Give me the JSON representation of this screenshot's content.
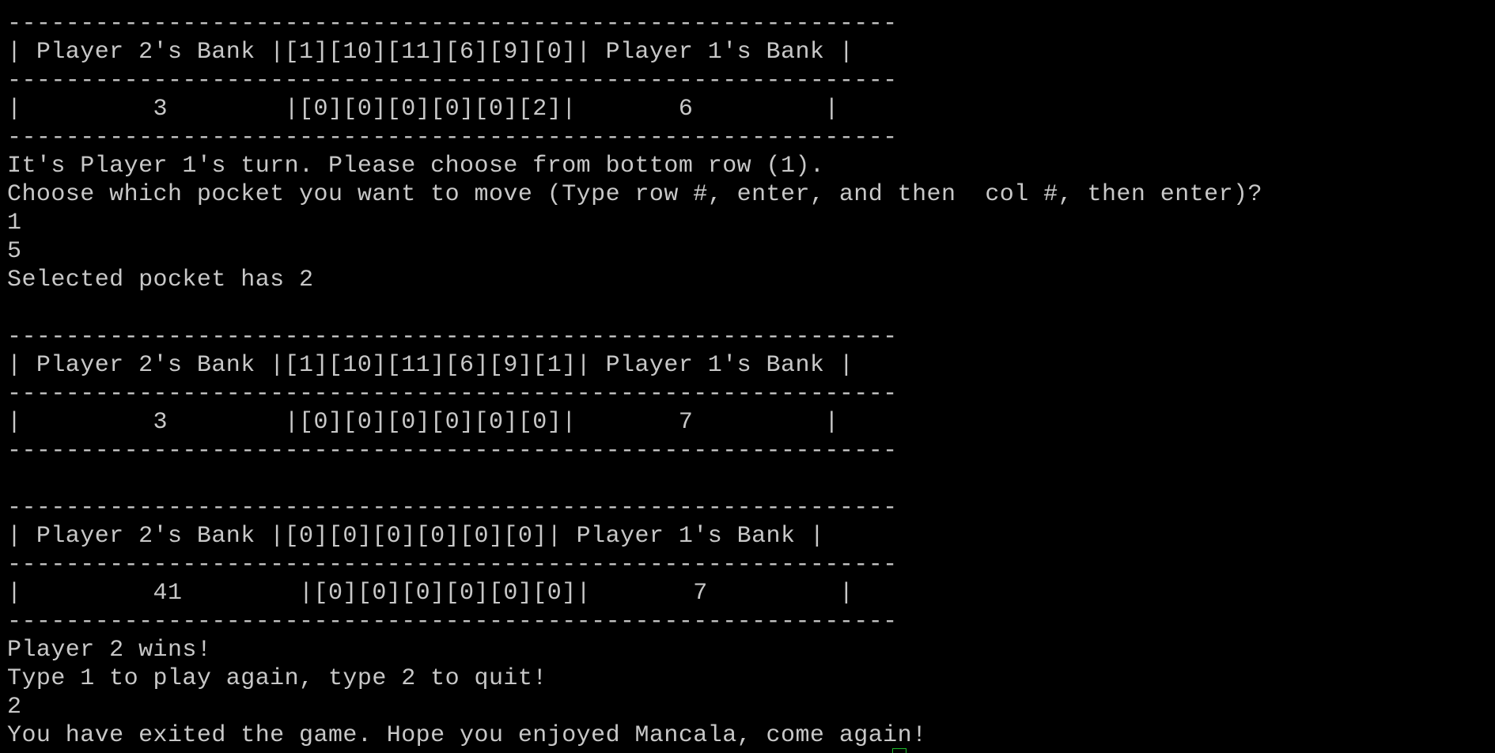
{
  "terminal": {
    "lines": [
      "-------------------------------------------------------------",
      "| Player 2's Bank |[1][10][11][6][9][0]| Player 1's Bank |",
      "-------------------------------------------------------------",
      "|         3        |[0][0][0][0][0][2]|       6         |",
      "-------------------------------------------------------------",
      "It's Player 1's turn. Please choose from bottom row (1).",
      "Choose which pocket you want to move (Type row #, enter, and then  col #, then enter)?",
      "1",
      "5",
      "Selected pocket has 2",
      "",
      "-------------------------------------------------------------",
      "| Player 2's Bank |[1][10][11][6][9][1]| Player 1's Bank |",
      "-------------------------------------------------------------",
      "|         3        |[0][0][0][0][0][0]|       7         |",
      "-------------------------------------------------------------",
      "",
      "-------------------------------------------------------------",
      "| Player 2's Bank |[0][0][0][0][0][0]| Player 1's Bank |",
      "-------------------------------------------------------------",
      "|         41        |[0][0][0][0][0][0]|       7         |",
      "-------------------------------------------------------------",
      "Player 2 wins!",
      "Type 1 to play again, type 2 to quit!",
      "2",
      "You have exited the game. Hope you enjoyed Mancala, come again!"
    ]
  },
  "colors": {
    "background": "#000000",
    "text": "#c8c8c8",
    "cursor": "#1fbf2f"
  }
}
